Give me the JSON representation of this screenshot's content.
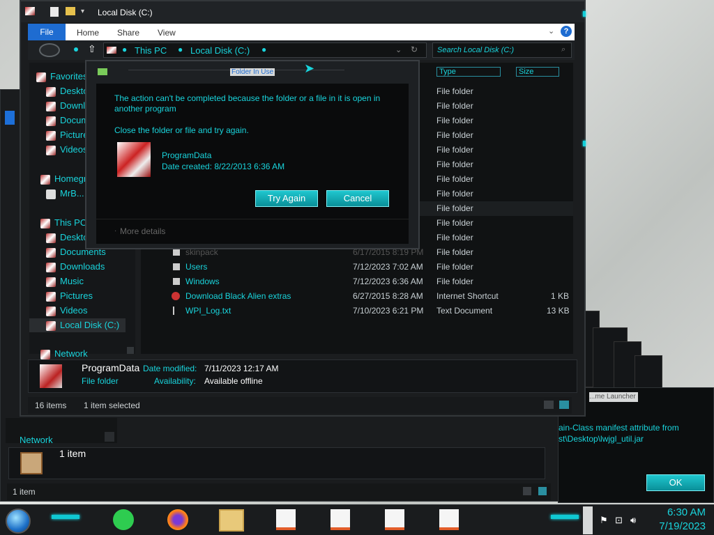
{
  "window": {
    "title": "Local Disk (C:)"
  },
  "ribbon": {
    "tabs": [
      "File",
      "Home",
      "Share",
      "View"
    ],
    "help": "?"
  },
  "address": {
    "crumbs": [
      "This PC",
      "Local Disk (C:)"
    ],
    "search_placeholder": "Search Local Disk (C:)"
  },
  "nav": {
    "favorites": "Favorites",
    "fav_items": [
      "Desktop",
      "Downloads",
      "Documents",
      "Pictures",
      "Videos"
    ],
    "homegroup": "Homegroup",
    "user": "MrB...",
    "thispc": "This PC",
    "pc_items": [
      "Desktop",
      "Documents",
      "Downloads",
      "Music",
      "Pictures",
      "Videos"
    ],
    "local_disk": "Local Disk (C:)",
    "network": "Network"
  },
  "columns": {
    "type": "Type",
    "size": "Size"
  },
  "folder_rows_type": "File folder",
  "files": [
    {
      "name": "skinpack",
      "date": "6/17/2015 8:19 PM",
      "type": "File folder",
      "size": ""
    },
    {
      "name": "Users",
      "date": "7/12/2023 7:02 AM",
      "type": "File folder",
      "size": ""
    },
    {
      "name": "Windows",
      "date": "7/12/2023 6:36 AM",
      "type": "File folder",
      "size": ""
    },
    {
      "name": "Download Black Alien extras",
      "date": "6/27/2015 8:28 AM",
      "type": "Internet Shortcut",
      "size": "1 KB"
    },
    {
      "name": "WPI_Log.txt",
      "date": "7/10/2023 6:21 PM",
      "type": "Text Document",
      "size": "13 KB"
    }
  ],
  "details": {
    "name": "ProgramData",
    "kind": "File folder",
    "modified_label": "Date modified:",
    "modified_value": "7/11/2023 12:17 AM",
    "avail_label": "Availability:",
    "avail_value": "Available offline"
  },
  "status": {
    "count": "16 items",
    "selected": "1 item selected"
  },
  "dialog": {
    "title": "Folder In Use",
    "message": "The action can't be completed because the folder or a file in it is open in another program",
    "hint": "Close the folder or file and try again.",
    "item_name": "ProgramData",
    "item_date": "Date created: 8/22/2013 6:36 AM",
    "try_again": "Try Again",
    "cancel": "Cancel",
    "more": "More details"
  },
  "bgwin": {
    "network": "Network",
    "item": "1 item",
    "status": "1 item"
  },
  "msgbox": {
    "title": "...me Launcher",
    "line1": "ain-Class manifest attribute from",
    "line2": "st\\Desktop\\lwjgl_util.jar",
    "ok": "OK"
  },
  "clock": {
    "time": "6:30 AM",
    "date": "7/19/2023"
  }
}
